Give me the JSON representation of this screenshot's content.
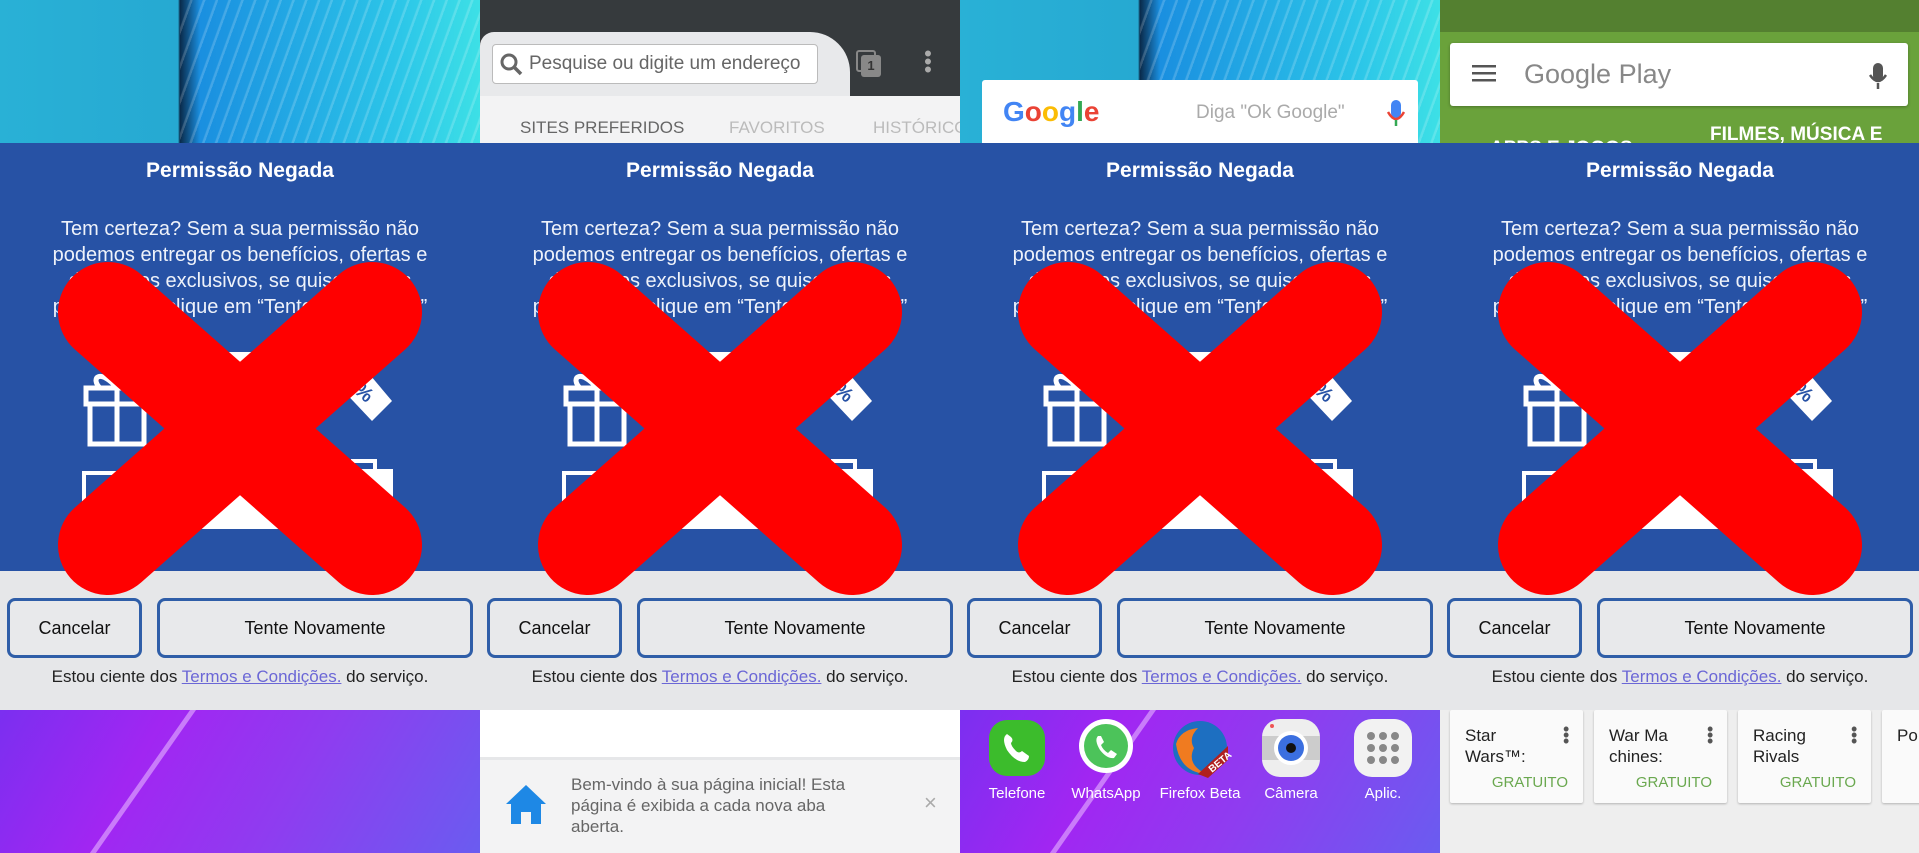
{
  "dialog": {
    "title": "Permissão Negada",
    "message": "Tem certeza? Sem a sua permissão não podemos entregar os benefícios, ofertas e descontos exclusivos, se quiser dar as permissões, clique em “Tente Novamente”",
    "cancel_label": "Cancelar",
    "retry_label": "Tente Novamente",
    "terms_prefix": "Estou ciente dos ",
    "terms_link": "Termos e Condições.",
    "terms_suffix": " do serviço."
  },
  "colors": {
    "dialog_blue": "#2752a5",
    "rejected_mark": "#ff0000",
    "terms_link": "#6b67d6",
    "free_green": "#6aa84f"
  },
  "browser": {
    "search_placeholder": "Pesquise ou digite um endereço",
    "tab_count": "1",
    "tabs": [
      "SITES PREFERIDOS",
      "FAVORITOS",
      "HISTÓRICO"
    ],
    "welcome_text": "Bem-vindo à sua página inicial! Esta página é exibida a cada nova aba aberta.",
    "close_label": "×"
  },
  "home": {
    "google_logo": "Google",
    "search_hint": "Diga \"Ok Google\"",
    "dock": [
      {
        "label": "Telefone",
        "icon": "phone-icon"
      },
      {
        "label": "WhatsApp",
        "icon": "whatsapp-icon"
      },
      {
        "label": "Firefox Beta",
        "icon": "firefox-beta-icon"
      },
      {
        "label": "Câmera",
        "icon": "camera-icon"
      },
      {
        "label": "Aplic.",
        "icon": "apps-grid-icon"
      }
    ]
  },
  "play": {
    "search_label": "Google Play",
    "tab_left": "APPS E JOGOS",
    "tab_right": "FILMES, MÚSICA E",
    "cards": [
      {
        "title": "Star Wars™:",
        "price": "GRATUITO"
      },
      {
        "title": "War Ma chines:",
        "price": "GRATUITO"
      },
      {
        "title": "Racing Rivals",
        "price": "GRATUITO"
      },
      {
        "title": "Po mo",
        "price": ""
      }
    ]
  }
}
